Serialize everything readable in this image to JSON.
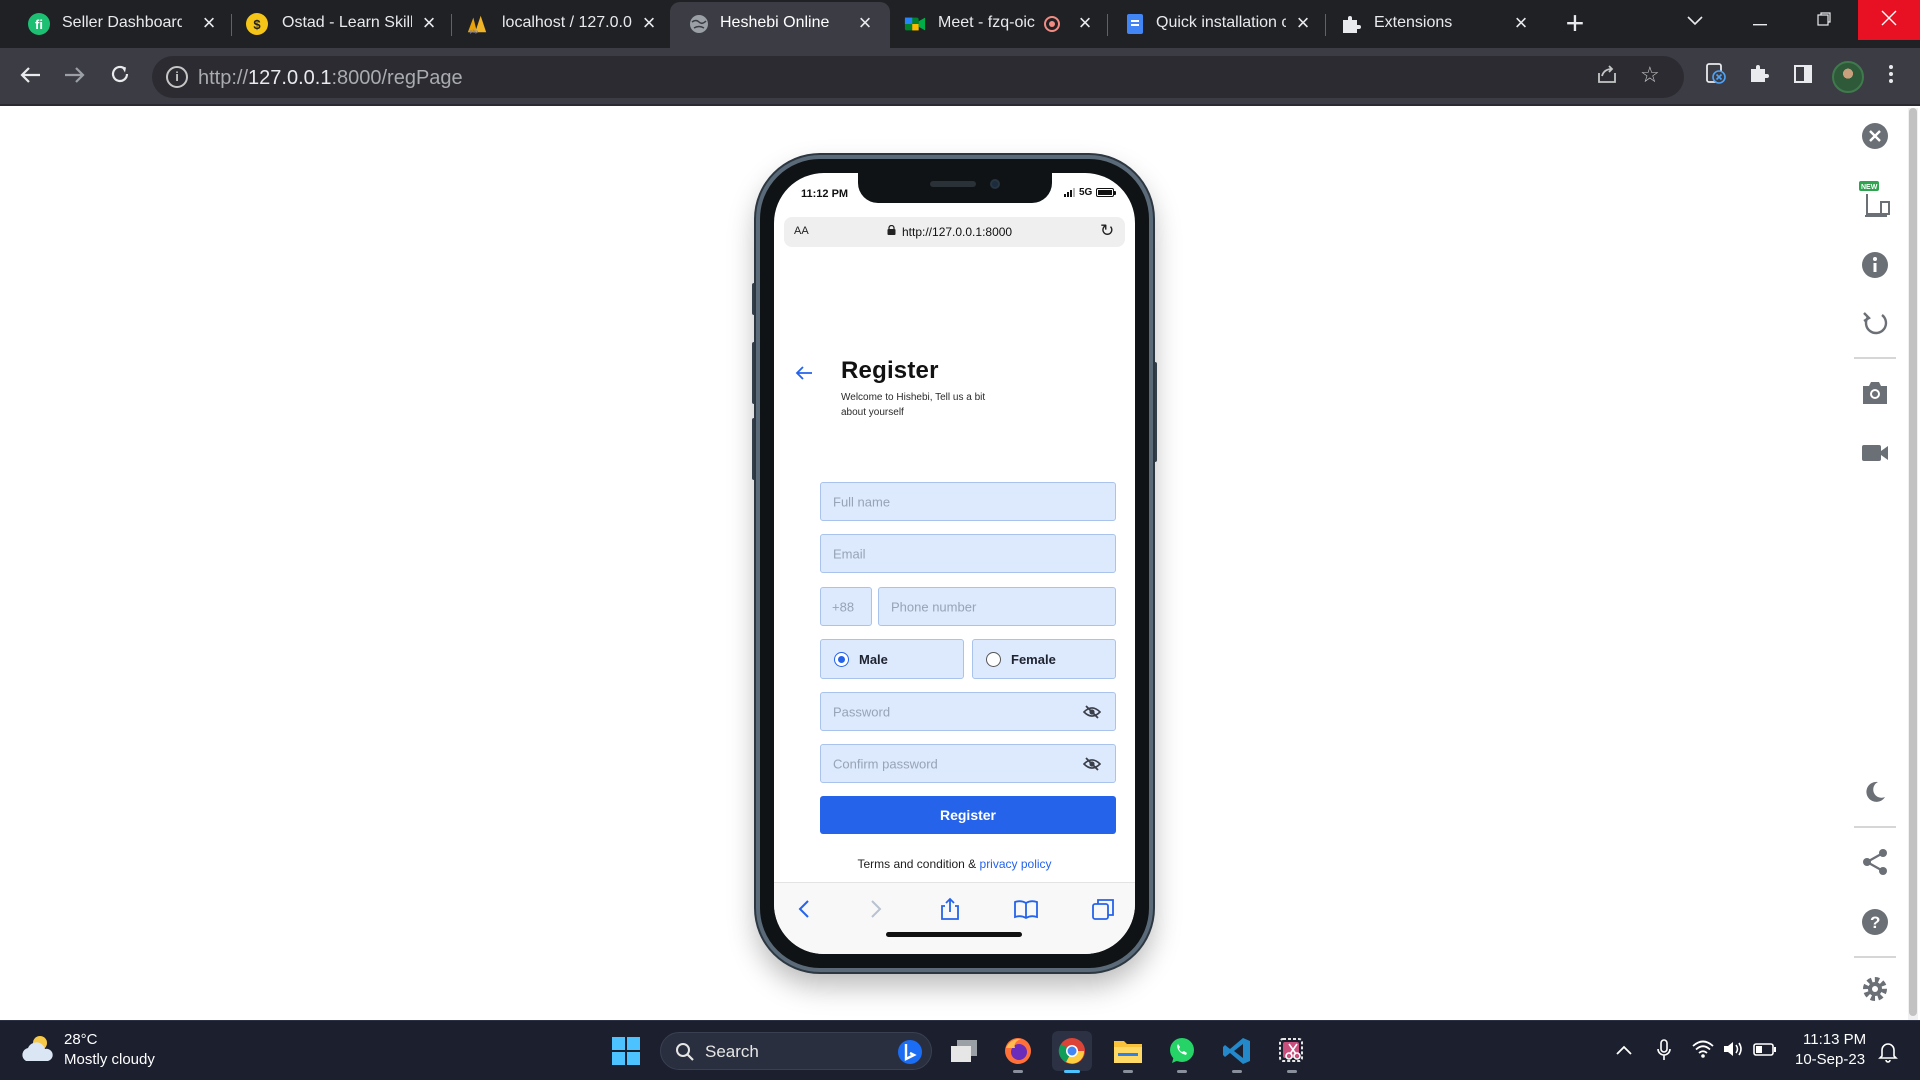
{
  "browser": {
    "tabs": [
      {
        "title": "Seller Dashboard",
        "favicon": "fiverr-icon",
        "active": false
      },
      {
        "title": "Ostad - Learn Skills",
        "favicon": "ostad-icon",
        "active": false
      },
      {
        "title": "localhost / 127.0.0.",
        "favicon": "phpmyadmin-icon",
        "active": false
      },
      {
        "title": "Heshebi Online",
        "favicon": "globe-icon",
        "active": true
      },
      {
        "title": "Meet - fzq-oic",
        "favicon": "google-meet-icon",
        "active": false
      },
      {
        "title": "Quick installation c",
        "favicon": "docs-icon",
        "active": false
      },
      {
        "title": "Extensions",
        "favicon": "puzzle-icon",
        "active": false
      }
    ],
    "address": {
      "host": "127.0.0.1",
      "rest": ":8000/regPage",
      "prefix": "http://"
    },
    "colors": {
      "tabbar": "#202124",
      "toolbar": "#3c3c45"
    }
  },
  "device_toolbar": {
    "new_badge": "NEW"
  },
  "phone": {
    "status": {
      "time": "11:12 PM",
      "network": "5G"
    },
    "safari": {
      "aa": "AA",
      "url": "http://127.0.0.1:8000"
    }
  },
  "page": {
    "title": "Register",
    "subtitle": "Welcome to Hishebi, Tell us a bit about yourself",
    "fields": {
      "full_name_placeholder": "Full name",
      "email_placeholder": "Email",
      "country_code": "+88",
      "phone_placeholder": "Phone number",
      "password_placeholder": "Password",
      "confirm_password_placeholder": "Confirm password"
    },
    "gender": {
      "options": [
        "Male",
        "Female"
      ],
      "selected": "Male"
    },
    "submit_label": "Register",
    "terms_text": "Terms and condition & ",
    "privacy_link": "privacy policy",
    "colors": {
      "primary": "#2563eb",
      "field_bg": "#dde9fc"
    }
  },
  "taskbar": {
    "weather": {
      "temp": "28°C",
      "desc": "Mostly cloudy"
    },
    "search_label": "Search",
    "clock": {
      "time": "11:13 PM",
      "date": "10-Sep-23"
    }
  }
}
